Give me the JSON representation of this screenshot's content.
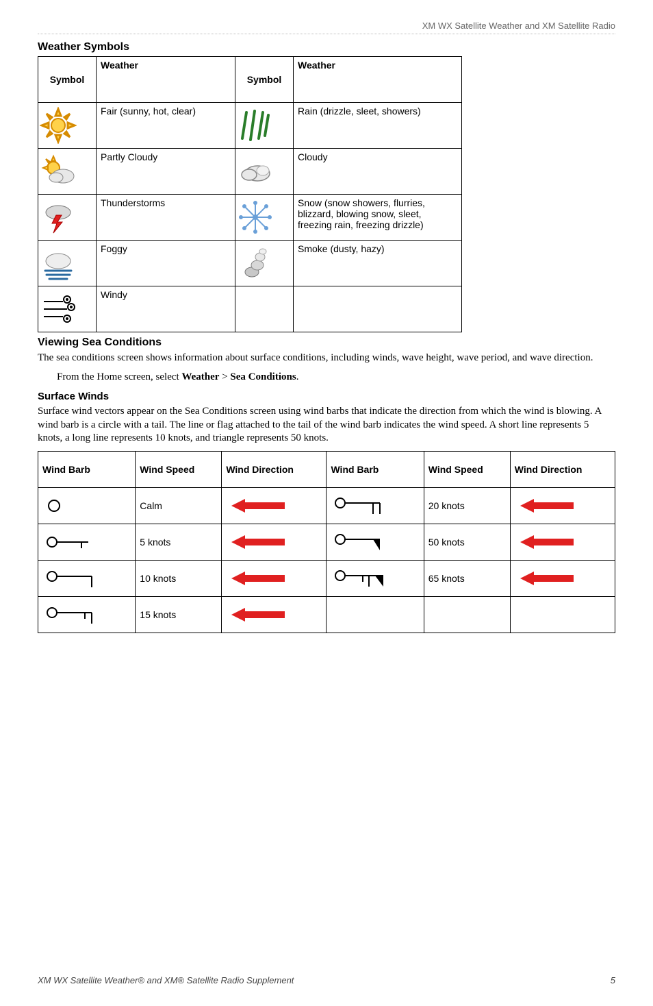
{
  "header": {
    "right": "XM WX Satellite Weather and XM Satellite Radio"
  },
  "weather_symbols": {
    "heading": "Weather Symbols",
    "cols": [
      "Symbol",
      "Weather",
      "Symbol",
      "Weather"
    ],
    "rows": [
      {
        "left": "Fair (sunny, hot, clear)",
        "right": "Rain (drizzle, sleet, showers)"
      },
      {
        "left": "Partly Cloudy",
        "right": "Cloudy"
      },
      {
        "left": "Thunderstorms",
        "right": "Snow (snow showers, flurries, blizzard, blowing snow, sleet, freezing rain, freezing drizzle)"
      },
      {
        "left": "Foggy",
        "right": "Smoke (dusty, hazy)"
      },
      {
        "left": "Windy",
        "right": ""
      }
    ]
  },
  "sea": {
    "heading": "Viewing Sea Conditions",
    "para": "The sea conditions screen shows information about surface conditions, including winds, wave height, wave period, and wave direction.",
    "cmd_pre": "From the Home screen, select ",
    "cmd_b1": "Weather",
    "cmd_sep": " > ",
    "cmd_b2": "Sea Conditions",
    "cmd_post": "."
  },
  "surface_winds": {
    "heading": "Surface Winds",
    "para": "Surface wind vectors appear on the Sea Conditions screen using wind barbs that indicate the direction from which the wind is blowing. A wind barb is a circle with a tail. The line or flag attached to the tail of the wind barb indicates the wind speed. A short line represents 5 knots, a long line represents 10 knots, and triangle represents 50 knots."
  },
  "wind_table": {
    "cols": [
      "Wind Barb",
      "Wind Speed",
      "Wind Direction",
      "Wind Barb",
      "Wind Speed",
      "Wind Direction"
    ],
    "rows": [
      {
        "left_speed": "Calm",
        "right_speed": "20 knots"
      },
      {
        "left_speed": "5 knots",
        "right_speed": "50 knots"
      },
      {
        "left_speed": "10 knots",
        "right_speed": "65 knots"
      },
      {
        "left_speed": "15 knots",
        "right_speed": ""
      }
    ]
  },
  "footer": {
    "left": "XM WX Satellite Weather® and XM® Satellite Radio Supplement",
    "right": "5"
  }
}
